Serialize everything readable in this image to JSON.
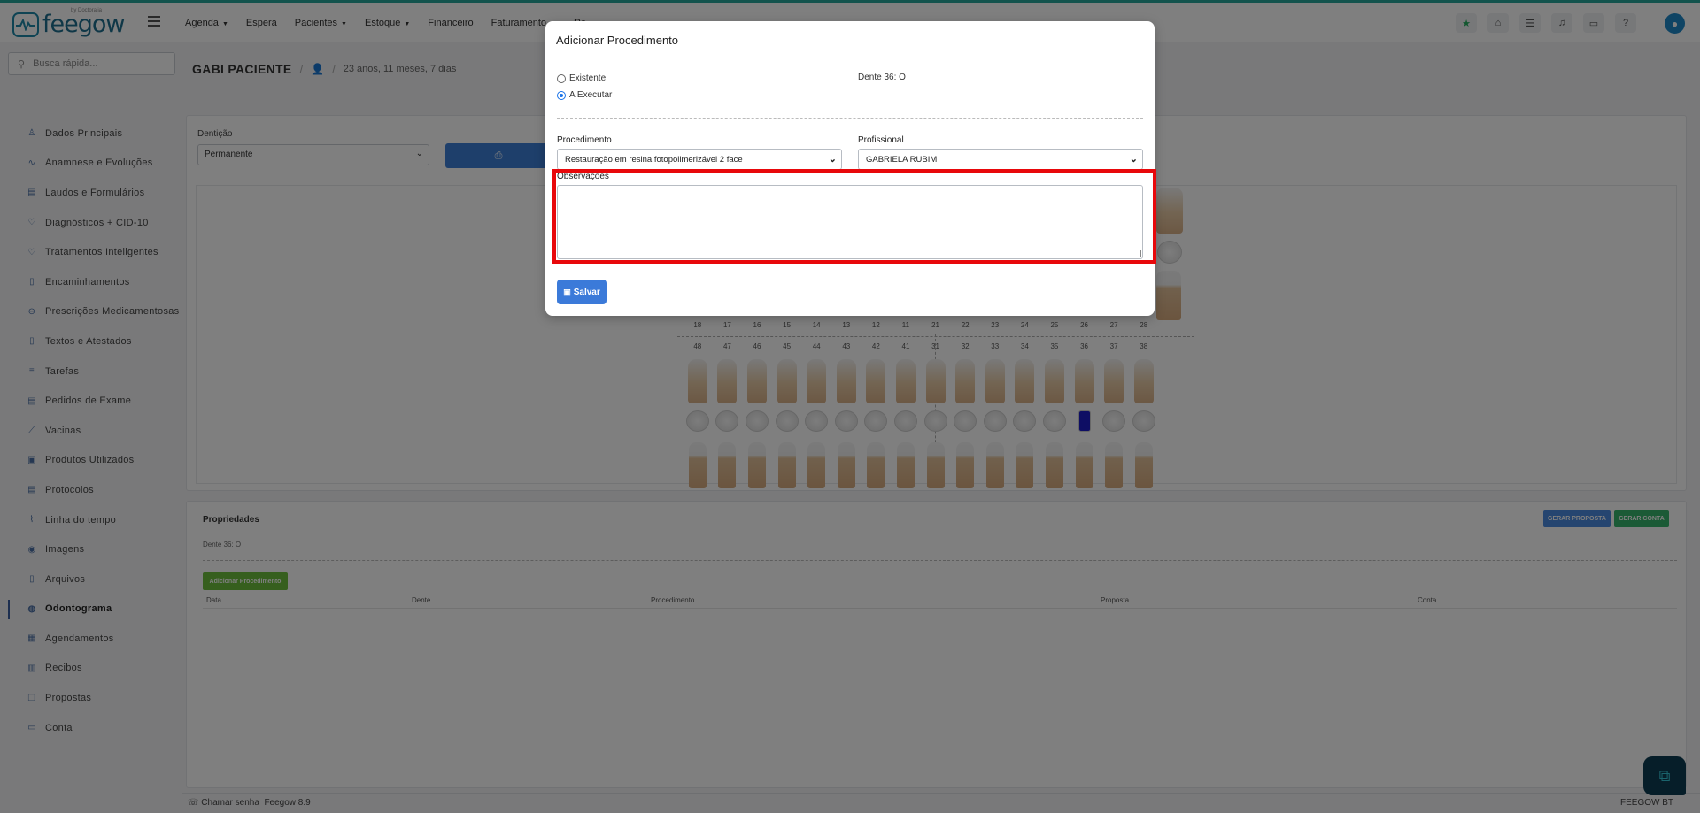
{
  "app": {
    "logo_text": "feegow",
    "logo_sub": "by Doctoralia"
  },
  "nav": [
    {
      "label": "Agenda",
      "dropdown": true
    },
    {
      "label": "Espera",
      "dropdown": false
    },
    {
      "label": "Pacientes",
      "dropdown": true
    },
    {
      "label": "Estoque",
      "dropdown": true
    },
    {
      "label": "Financeiro",
      "dropdown": false
    },
    {
      "label": "Faturamento",
      "dropdown": true
    },
    {
      "label": "Re",
      "dropdown": false
    }
  ],
  "top_icons": [
    "star-icon",
    "inbox-icon",
    "checklist-icon",
    "bell-icon",
    "chat-icon",
    "help-icon"
  ],
  "search": {
    "placeholder": "Busca rápida..."
  },
  "sidebar": {
    "items": [
      {
        "label": "Dados Principais",
        "icon": "user-icon"
      },
      {
        "label": "Anamnese e Evoluções",
        "icon": "chart-icon"
      },
      {
        "label": "Laudos e Formulários",
        "icon": "clipboard-icon"
      },
      {
        "label": "Diagnósticos + CID-10",
        "icon": "stethoscope-icon"
      },
      {
        "label": "Tratamentos Inteligentes",
        "icon": "stethoscope-icon"
      },
      {
        "label": "Encaminhamentos",
        "icon": "document-icon"
      },
      {
        "label": "Prescrições Medicamentosas",
        "icon": "pills-icon"
      },
      {
        "label": "Textos e Atestados",
        "icon": "document-icon"
      },
      {
        "label": "Tarefas",
        "icon": "list-icon"
      },
      {
        "label": "Pedidos de Exame",
        "icon": "clipboard-icon"
      },
      {
        "label": "Vacinas",
        "icon": "syringe-icon"
      },
      {
        "label": "Produtos Utilizados",
        "icon": "box-icon"
      },
      {
        "label": "Protocolos",
        "icon": "clipboard-icon"
      },
      {
        "label": "Linha do tempo",
        "icon": "timeline-icon"
      },
      {
        "label": "Imagens",
        "icon": "camera-icon"
      },
      {
        "label": "Arquivos",
        "icon": "file-icon"
      },
      {
        "label": "Odontograma",
        "icon": "tooth-icon",
        "active": true
      },
      {
        "label": "Agendamentos",
        "icon": "calendar-icon"
      },
      {
        "label": "Recibos",
        "icon": "receipt-icon"
      },
      {
        "label": "Propostas",
        "icon": "copy-icon"
      },
      {
        "label": "Conta",
        "icon": "money-icon"
      }
    ]
  },
  "patient": {
    "name": "GABI PACIENTE",
    "age": "23 anos, 11 meses, 7 dias"
  },
  "odontogram": {
    "denticao_label": "Dentição",
    "denticao_value": "Permanente",
    "upper_numbers": [
      "18",
      "17",
      "16",
      "15",
      "14",
      "13",
      "12",
      "11",
      "21",
      "22",
      "23",
      "24",
      "25",
      "26",
      "27",
      "28"
    ],
    "lower_numbers": [
      "48",
      "47",
      "46",
      "45",
      "44",
      "43",
      "42",
      "41",
      "31",
      "32",
      "33",
      "34",
      "35",
      "36",
      "37",
      "38"
    ],
    "marked_tooth": "36"
  },
  "properties": {
    "title": "Propriedades",
    "tooth_info": "Dente 36: O",
    "gerar_proposta": "GERAR PROPOSTA",
    "gerar_conta": "GERAR CONTA",
    "add_procedure": "Adicionar Procedimento",
    "columns": [
      "Data",
      "Dente",
      "Procedimento",
      "Proposta",
      "Conta"
    ]
  },
  "statusbar": {
    "left": "Chamar senha",
    "version": "Feegow 8.9",
    "right": "FEEGOW BT"
  },
  "colors": {
    "brand": "#1e6f8f",
    "primary": "#3b7ad9",
    "success": "#37b56c",
    "highlight": "#e8080b",
    "marked_surface": "#1d1dc9"
  },
  "modal": {
    "title": "Adicionar Procedimento",
    "radio_existente": "Existente",
    "radio_executar": "A Executar",
    "selected_radio": "A Executar",
    "tooth_info": "Dente 36: O",
    "procedimento_label": "Procedimento",
    "procedimento_value": "Restauração em resina fotopolimerizável 2 face",
    "profissional_label": "Profissional",
    "profissional_value": "GABRIELA RUBIM",
    "observacoes_label": "Observações",
    "observacoes_value": "",
    "save_label": "Salvar"
  }
}
